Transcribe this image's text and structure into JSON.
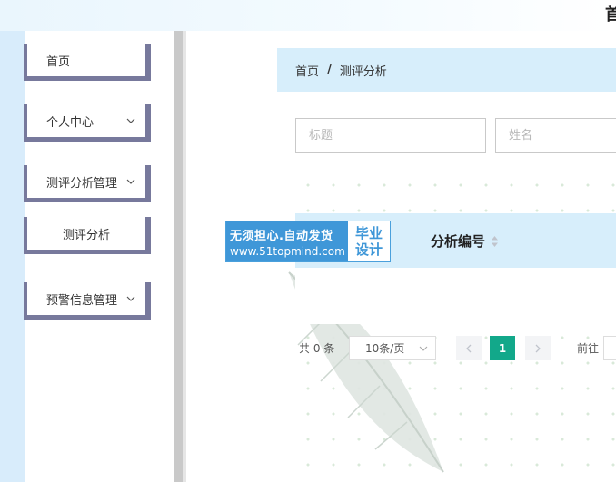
{
  "header": {
    "app_title": "首"
  },
  "sidebar": {
    "items": [
      {
        "label": "首页"
      },
      {
        "label": "个人中心"
      },
      {
        "label": "测评分析管理"
      },
      {
        "label": "预警信息管理"
      }
    ],
    "subitem": {
      "label": "测评分析"
    }
  },
  "breadcrumb": {
    "home": "首页",
    "separator": "/",
    "current": "测评分析"
  },
  "search": {
    "title_placeholder": "标题",
    "name_placeholder": "姓名"
  },
  "table": {
    "columns": [
      {
        "label": "分析编号"
      }
    ],
    "rows": []
  },
  "pagination": {
    "total_text": "共 0 条",
    "page_size": "10条/页",
    "current_page": "1",
    "goto_label": "前往"
  },
  "watermark": {
    "line1": "无须担心.自动发货",
    "line2": "www.51topmind.com",
    "badge_line1": "毕业",
    "badge_line2": "设计"
  },
  "colors": {
    "accent": "#12a88a",
    "menu_border": "#77799c",
    "light_blue": "#d7eefb",
    "watermark_blue": "#3f97d8"
  }
}
